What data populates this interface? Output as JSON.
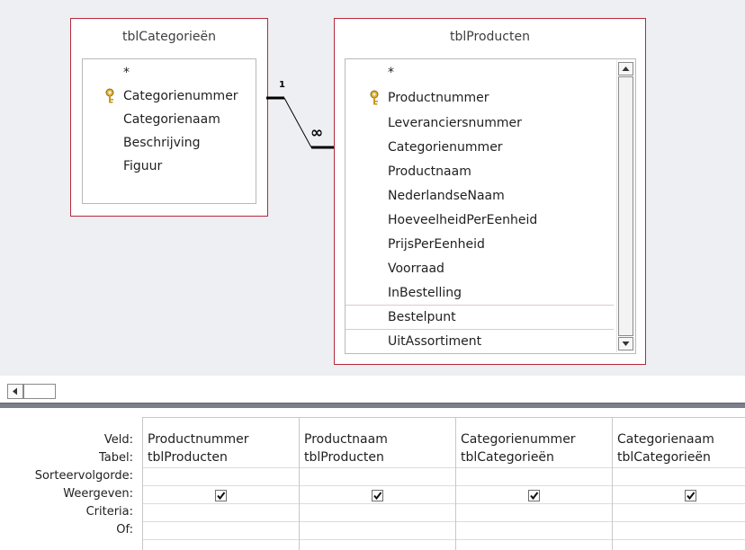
{
  "design": {
    "tables": [
      {
        "name": "tblCategorieën",
        "fields": [
          "*",
          "Categorienummer",
          "Categorienaam",
          "Beschrijving",
          "Figuur"
        ],
        "key_field": "Categorienummer"
      },
      {
        "name": "tblProducten",
        "fields": [
          "*",
          "Productnummer",
          "Leveranciersnummer",
          "Categorienummer",
          "Productnaam",
          "NederlandseNaam",
          "HoeveelheidPerEenheid",
          "PrijsPerEenheid",
          "Voorraad",
          "InBestelling",
          "Bestelpunt",
          "UitAssortiment"
        ],
        "key_field": "Productnummer"
      }
    ],
    "relationship": {
      "one_label": "1",
      "many_label": "∞"
    }
  },
  "grid": {
    "row_labels": [
      "Veld:",
      "Tabel:",
      "Sorteervolgorde:",
      "Weergeven:",
      "Criteria:",
      "Of:"
    ],
    "columns": [
      {
        "veld": "Productnummer",
        "tabel": "tblProducten",
        "weergeven": true
      },
      {
        "veld": "Productnaam",
        "tabel": "tblProducten",
        "weergeven": true
      },
      {
        "veld": "Categorienummer",
        "tabel": "tblCategorieën",
        "weergeven": true
      },
      {
        "veld": "Categorienaam",
        "tabel": "tblCategorieën",
        "weergeven": true
      }
    ]
  },
  "colors": {
    "table_border": "#b52a3a",
    "pane_bg": "#eeeff3",
    "splitter": "#7a7f89"
  }
}
